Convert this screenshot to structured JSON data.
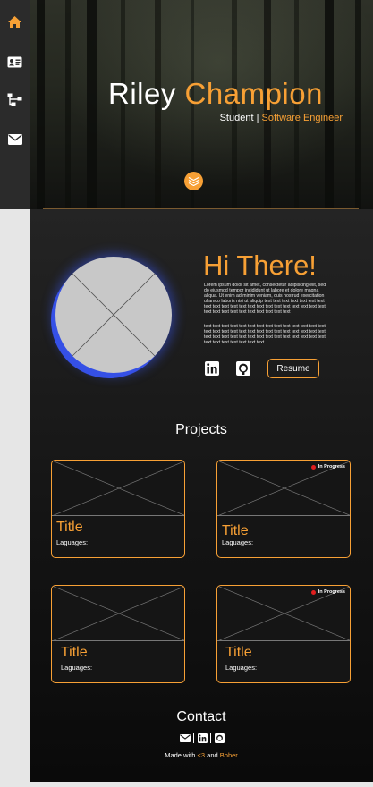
{
  "nav": {
    "items": [
      {
        "icon": "home-icon",
        "active": true
      },
      {
        "icon": "id-card-icon",
        "active": false
      },
      {
        "icon": "sitemap-icon",
        "active": false
      },
      {
        "icon": "envelope-icon",
        "active": false
      }
    ]
  },
  "hero": {
    "first_name": "Riley",
    "last_name": "Champion",
    "role_1": "Student",
    "separator": "|",
    "role_2": "Software Engineer"
  },
  "about": {
    "heading": "Hi There!",
    "paragraph_1": "Lorem ipsum dolor sit amet, consectetur adipiscing elit, sed do eiusmod tempor incididunt ut labore et dolore magna aliqua. Ut enim ad minim veniam, quis nostrud exercitation ullamco laboris nisi ut aliquip text text text text text text text text text text text text text text text text text text text text text text text text text text text text text text text",
    "paragraph_2": "text text text text text text text text text text text text text text text text text text text text text text text text text text text text text text text text text text text text text text text text text text text text text text text text text",
    "resume_label": "Resume"
  },
  "projects": {
    "heading": "Projects",
    "cards": [
      {
        "title": "Title",
        "languages": "Laguages:",
        "badge": ""
      },
      {
        "title": "Title",
        "languages": "Laguages:",
        "badge": "In Progress"
      },
      {
        "title": "Title",
        "languages": "Laguages:",
        "badge": ""
      },
      {
        "title": "Title",
        "languages": "Laguages:",
        "badge": "In Progress"
      }
    ]
  },
  "contact": {
    "heading": "Contact",
    "footer_prefix": "Made with",
    "footer_heart": "<3",
    "footer_and": "and",
    "footer_name": "Bober"
  },
  "colors": {
    "accent": "#f7a035",
    "avatar_glow": "#3550e6",
    "badge_dot": "#e01e1e",
    "sidebar": "#2b2b2b"
  }
}
